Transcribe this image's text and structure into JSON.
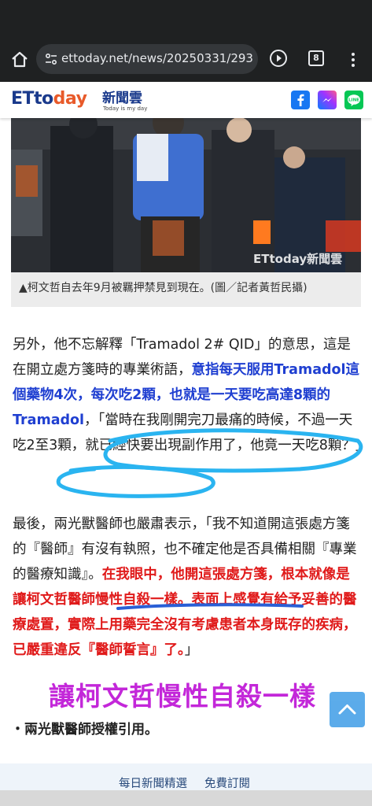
{
  "browser": {
    "url": "ettoday.net/news/20250331/293",
    "tab_count": "8"
  },
  "site": {
    "logo_text_1": "ETto",
    "logo_text_2": "day",
    "logo_cn": "新聞雲",
    "logo_tagline": "Today is my day",
    "watermark": "ETtoday新聞雲",
    "share_icons": [
      "facebook-icon",
      "messenger-icon",
      "line-icon"
    ]
  },
  "article": {
    "caption": "▲柯文哲自去年9月被羈押禁見到現在。(圖／記者黃哲民攝)",
    "p1_a": "另外，他不忘解釋「Tramadol 2# QID」的意思，這是在開立處方箋時的專業術語，",
    "p1_b": "意指每天服用Tramadol這個藥物4次，每次吃2顆，也就是一天要吃高達8顆的Tramadol",
    "p1_c": "，「當時在我剛開完刀最痛的時候，不過一天吃2至3顆，就已經快要出現副作用了，他竟一天吃8顆？」",
    "p2_a": "最後，兩光獸醫師也嚴肅表示，「我不知道開這張處方箋的『醫師』有沒有執照，也不確定他是否具備相關『專業的醫療知識』。",
    "p2_b": "在我眼中，他開這張處方箋，根本就像是讓柯文哲醫師慢性自殺一樣。表面上感覺有給予妥善的醫療處置，實際上用藥完全沒有考慮患者本身既存的疾病，已嚴重違反『醫師誓言』了。",
    "p2_c": "」",
    "overlay_caption": "讓柯文哲慢性自殺一樣",
    "credit": "・兩光獸醫師授權引用。"
  },
  "footer": {
    "link_1": "每日新聞精選",
    "link_2": "免費訂閱"
  },
  "colors": {
    "accent_blue": "#1f3fd1",
    "accent_red": "#e01a1a",
    "highlight_purple": "#c327d9",
    "annotation_cyan": "#2ab4f0"
  }
}
